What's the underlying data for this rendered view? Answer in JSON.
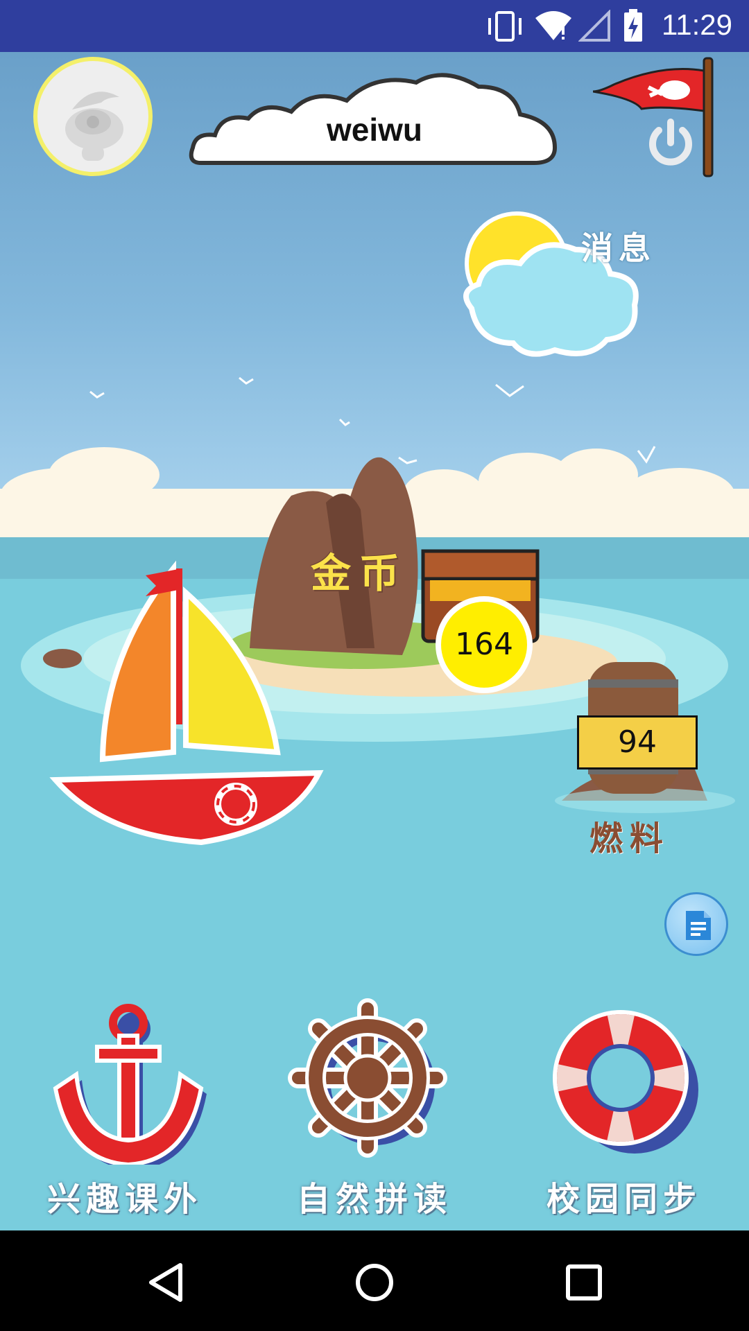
{
  "status_bar": {
    "time": "11:29",
    "icons": [
      "vibrate-icon",
      "wifi-icon",
      "signal-icon",
      "battery-charging-icon"
    ]
  },
  "header": {
    "username": "weiwu",
    "avatar_icon": "avatar-icon",
    "logout_icon": "power-icon",
    "flag_icon": "pirate-flag-icon"
  },
  "scene": {
    "messages_label": "消息",
    "coins_label": "金币",
    "coins_value": "164",
    "fuel_label": "燃料",
    "fuel_value": "94"
  },
  "bottom_nav": [
    {
      "label": "兴趣课外",
      "icon": "anchor-icon"
    },
    {
      "label": "自然拼读",
      "icon": "ship-wheel-icon"
    },
    {
      "label": "校园同步",
      "icon": "lifebuoy-icon"
    }
  ],
  "fab": {
    "icon": "document-icon"
  },
  "android_nav": {
    "icons": [
      "back-icon",
      "home-icon",
      "recents-icon"
    ]
  },
  "colors": {
    "status_bar": "#2f3e9e",
    "sea": "#79cddd",
    "sky": "#83b8dc",
    "coin_badge": "#ffee00",
    "fuel_badge": "#f4cf47"
  }
}
